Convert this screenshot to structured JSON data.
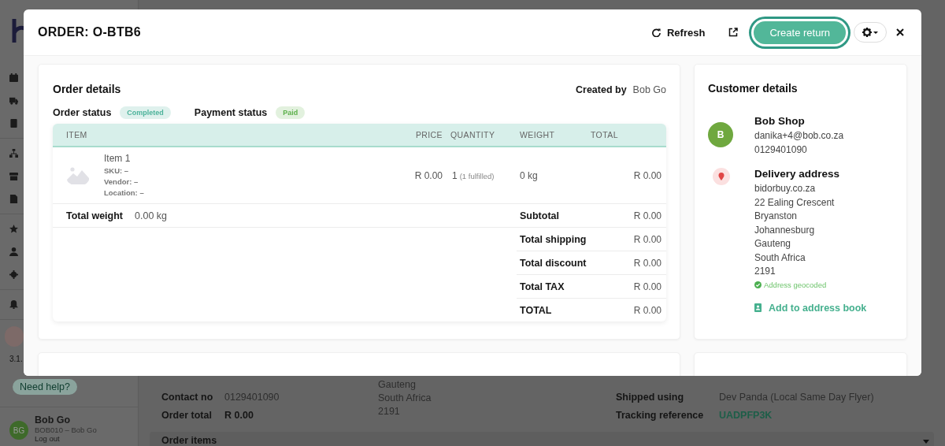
{
  "sidebar": {
    "version": "3.1.",
    "help": "Need help?",
    "user": {
      "initials": "BG",
      "name": "Bob Go",
      "account": "BOB010 – Bob Go",
      "logout": "Log out"
    }
  },
  "background": {
    "left": [
      {
        "label": "Contact no",
        "value": "0129401090",
        "kind": "plain"
      },
      {
        "label": "Order total",
        "value": "R 0.00",
        "kind": "strong"
      }
    ],
    "address_lines": [
      "Gauteng",
      "South Africa",
      "2191"
    ],
    "right": [
      {
        "label": "Shipped using",
        "value": "Dev Panda (Local Same Day Flyer)",
        "kind": "plain"
      },
      {
        "label": "Tracking reference",
        "value": "UADPFP3K",
        "kind": "link"
      }
    ],
    "section": "Order items"
  },
  "modal": {
    "title": "ORDER: O-BTB6",
    "refresh": "Refresh",
    "create_return": "Create return",
    "order_details": {
      "title": "Order details",
      "created_by_label": "Created by",
      "created_by": "Bob Go",
      "statuses": [
        {
          "label": "Order status",
          "badge": "Completed",
          "color": "#4db39b"
        },
        {
          "label": "Payment status",
          "badge": "Paid",
          "color": "#5cb04a"
        }
      ],
      "columns": [
        "ITEM",
        "PRICE",
        "QUANTITY",
        "WEIGHT",
        "TOTAL"
      ],
      "items": [
        {
          "name": "Item 1",
          "meta": [
            "SKU: –",
            "Vendor: –",
            "Location: –"
          ],
          "price": "R 0.00",
          "quantity": "1",
          "fulfilled": "(1 fulfilled)",
          "weight": "0 kg",
          "total": "R 0.00"
        }
      ],
      "total_weight": {
        "label": "Total weight",
        "value": "0.00 kg"
      },
      "summary": [
        {
          "label": "Subtotal",
          "value": "R 0.00"
        },
        {
          "label": "Total shipping",
          "value": "R 0.00"
        },
        {
          "label": "Total discount",
          "value": "R 0.00"
        },
        {
          "label": "Total TAX",
          "value": "R 0.00"
        },
        {
          "label": "TOTAL",
          "value": "R 0.00"
        }
      ]
    },
    "customer": {
      "title": "Customer details",
      "initials": "B",
      "name": "Bob Shop",
      "email": "danika+4@bob.co.za",
      "phone": "0129401090",
      "delivery_title": "Delivery address",
      "address": [
        "bidorbuy.co.za",
        "22 Ealing Crescent",
        "Bryanston",
        "Johannesburg",
        "Gauteng",
        "South Africa",
        "2191"
      ],
      "geocoded": "Address geocoded",
      "add_link": "Add to address book"
    }
  }
}
